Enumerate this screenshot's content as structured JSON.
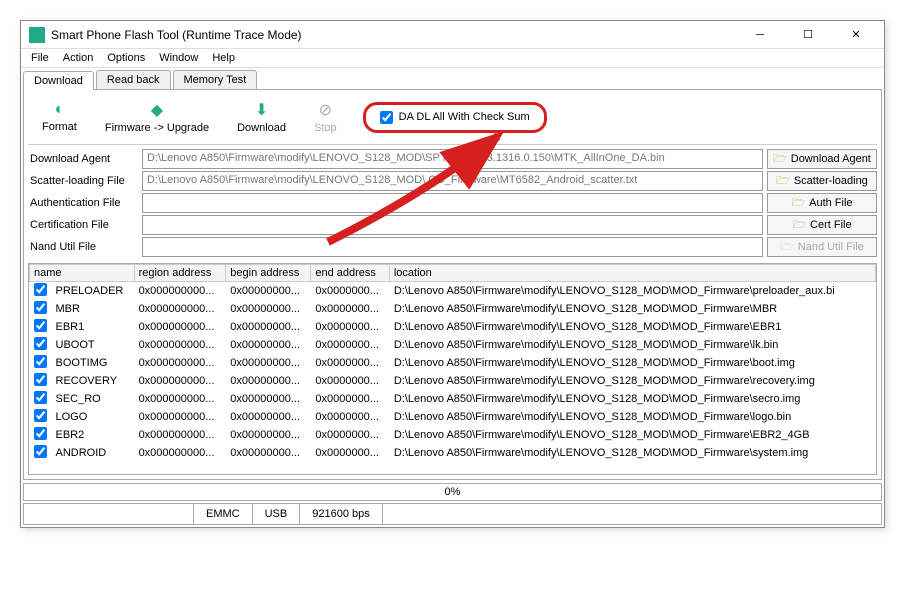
{
  "title": "Smart Phone Flash Tool (Runtime Trace Mode)",
  "menu": [
    "File",
    "Action",
    "Options",
    "Window",
    "Help"
  ],
  "tabs": [
    "Download",
    "Read back",
    "Memory Test"
  ],
  "toolbar": {
    "format": "Format",
    "firmware": "Firmware -> Upgrade",
    "download": "Download",
    "stop": "Stop",
    "checksum": "DA DL All With Check Sum"
  },
  "files": {
    "da_label": "Download Agent",
    "da_value": "D:\\Lenovo A850\\Firmware\\modify\\LENOVO_S128_MOD\\SP        h_Tool_v3.1316.0.150\\MTK_AllInOne_DA.bin",
    "da_btn": "Download Agent",
    "scatter_label": "Scatter-loading File",
    "scatter_value": "D:\\Lenovo A850\\Firmware\\modify\\LENOVO_S128_MOD\\       OD_Firmware\\MT6582_Android_scatter.txt",
    "scatter_btn": "Scatter-loading",
    "auth_label": "Authentication File",
    "auth_value": "",
    "auth_btn": "Auth File",
    "cert_label": "Certification File",
    "cert_value": "",
    "cert_btn": "Cert File",
    "nand_label": "Nand Util File",
    "nand_value": "",
    "nand_btn": "Nand Util File"
  },
  "columns": [
    "name",
    "region address",
    "begin address",
    "end address",
    "location"
  ],
  "rows": [
    {
      "name": "PRELOADER",
      "region": "0x000000000...",
      "begin": "0x00000000...",
      "end": "0x0000000...",
      "location": "D:\\Lenovo A850\\Firmware\\modify\\LENOVO_S128_MOD\\MOD_Firmware\\preloader_aux.bi"
    },
    {
      "name": "MBR",
      "region": "0x000000000...",
      "begin": "0x00000000...",
      "end": "0x0000000...",
      "location": "D:\\Lenovo A850\\Firmware\\modify\\LENOVO_S128_MOD\\MOD_Firmware\\MBR"
    },
    {
      "name": "EBR1",
      "region": "0x000000000...",
      "begin": "0x00000000...",
      "end": "0x0000000...",
      "location": "D:\\Lenovo A850\\Firmware\\modify\\LENOVO_S128_MOD\\MOD_Firmware\\EBR1"
    },
    {
      "name": "UBOOT",
      "region": "0x000000000...",
      "begin": "0x00000000...",
      "end": "0x0000000...",
      "location": "D:\\Lenovo A850\\Firmware\\modify\\LENOVO_S128_MOD\\MOD_Firmware\\lk.bin"
    },
    {
      "name": "BOOTIMG",
      "region": "0x000000000...",
      "begin": "0x00000000...",
      "end": "0x0000000...",
      "location": "D:\\Lenovo A850\\Firmware\\modify\\LENOVO_S128_MOD\\MOD_Firmware\\boot.img"
    },
    {
      "name": "RECOVERY",
      "region": "0x000000000...",
      "begin": "0x00000000...",
      "end": "0x0000000...",
      "location": "D:\\Lenovo A850\\Firmware\\modify\\LENOVO_S128_MOD\\MOD_Firmware\\recovery.img"
    },
    {
      "name": "SEC_RO",
      "region": "0x000000000...",
      "begin": "0x00000000...",
      "end": "0x0000000...",
      "location": "D:\\Lenovo A850\\Firmware\\modify\\LENOVO_S128_MOD\\MOD_Firmware\\secro.img"
    },
    {
      "name": "LOGO",
      "region": "0x000000000...",
      "begin": "0x00000000...",
      "end": "0x0000000...",
      "location": "D:\\Lenovo A850\\Firmware\\modify\\LENOVO_S128_MOD\\MOD_Firmware\\logo.bin"
    },
    {
      "name": "EBR2",
      "region": "0x000000000...",
      "begin": "0x00000000...",
      "end": "0x0000000...",
      "location": "D:\\Lenovo A850\\Firmware\\modify\\LENOVO_S128_MOD\\MOD_Firmware\\EBR2_4GB"
    },
    {
      "name": "ANDROID",
      "region": "0x000000000...",
      "begin": "0x00000000...",
      "end": "0x0000000...",
      "location": "D:\\Lenovo A850\\Firmware\\modify\\LENOVO_S128_MOD\\MOD_Firmware\\system.img"
    }
  ],
  "progress": "0%",
  "status": {
    "emmc": "EMMC",
    "usb": "USB",
    "baud": "921600 bps"
  }
}
